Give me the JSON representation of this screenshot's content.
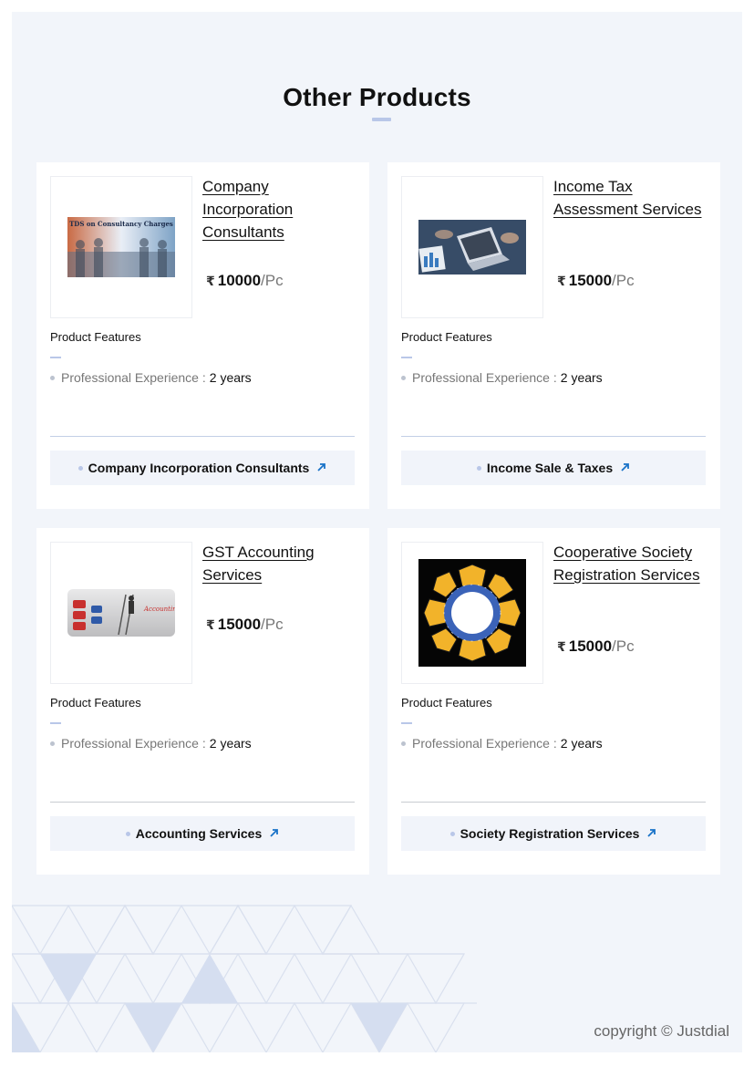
{
  "section": {
    "title": "Other Products"
  },
  "products": [
    {
      "title": "Company Incorporation Consultants",
      "image_text": "TDS on Consultancy Charges",
      "currency_icon": "rupee-icon",
      "currency_symbol": "₹",
      "price": "10000",
      "unit": "/Pc",
      "features_label": "Product Features",
      "feature_name": "Professional Experience :",
      "feature_value": "2 years",
      "link_label": "Company Incorporation Consultants",
      "link_icon": "arrow-up-right-icon"
    },
    {
      "title": "Income Tax Assessment Services",
      "currency_icon": "rupee-icon",
      "currency_symbol": "₹",
      "price": "15000",
      "unit": "/Pc",
      "features_label": "Product Features",
      "feature_name": "Professional Experience :",
      "feature_value": "2 years",
      "link_label": "Income Sale & Taxes",
      "link_icon": "arrow-up-right-icon"
    },
    {
      "title": "GST Accounting Services",
      "image_text": "Accounting Services",
      "currency_icon": "rupee-icon",
      "currency_symbol": "₹",
      "price": "15000",
      "unit": "/Pc",
      "features_label": "Product Features",
      "feature_name": "Professional Experience :",
      "feature_value": "2 years",
      "link_label": "Accounting Services",
      "link_icon": "arrow-up-right-icon"
    },
    {
      "title": "Cooperative Society Registration Services",
      "currency_icon": "rupee-icon",
      "currency_symbol": "₹",
      "price": "15000",
      "unit": "/Pc",
      "features_label": "Product Features",
      "feature_name": "Professional Experience :",
      "feature_value": "2 years",
      "link_label": "Society Registration Services",
      "link_icon": "arrow-up-right-icon"
    }
  ],
  "footer": {
    "copyright": "copyright © Justdial"
  },
  "colors": {
    "page_background": "#f2f5fa",
    "accent_bar": "#b9c7e8",
    "arrow": "#1a73c8"
  }
}
